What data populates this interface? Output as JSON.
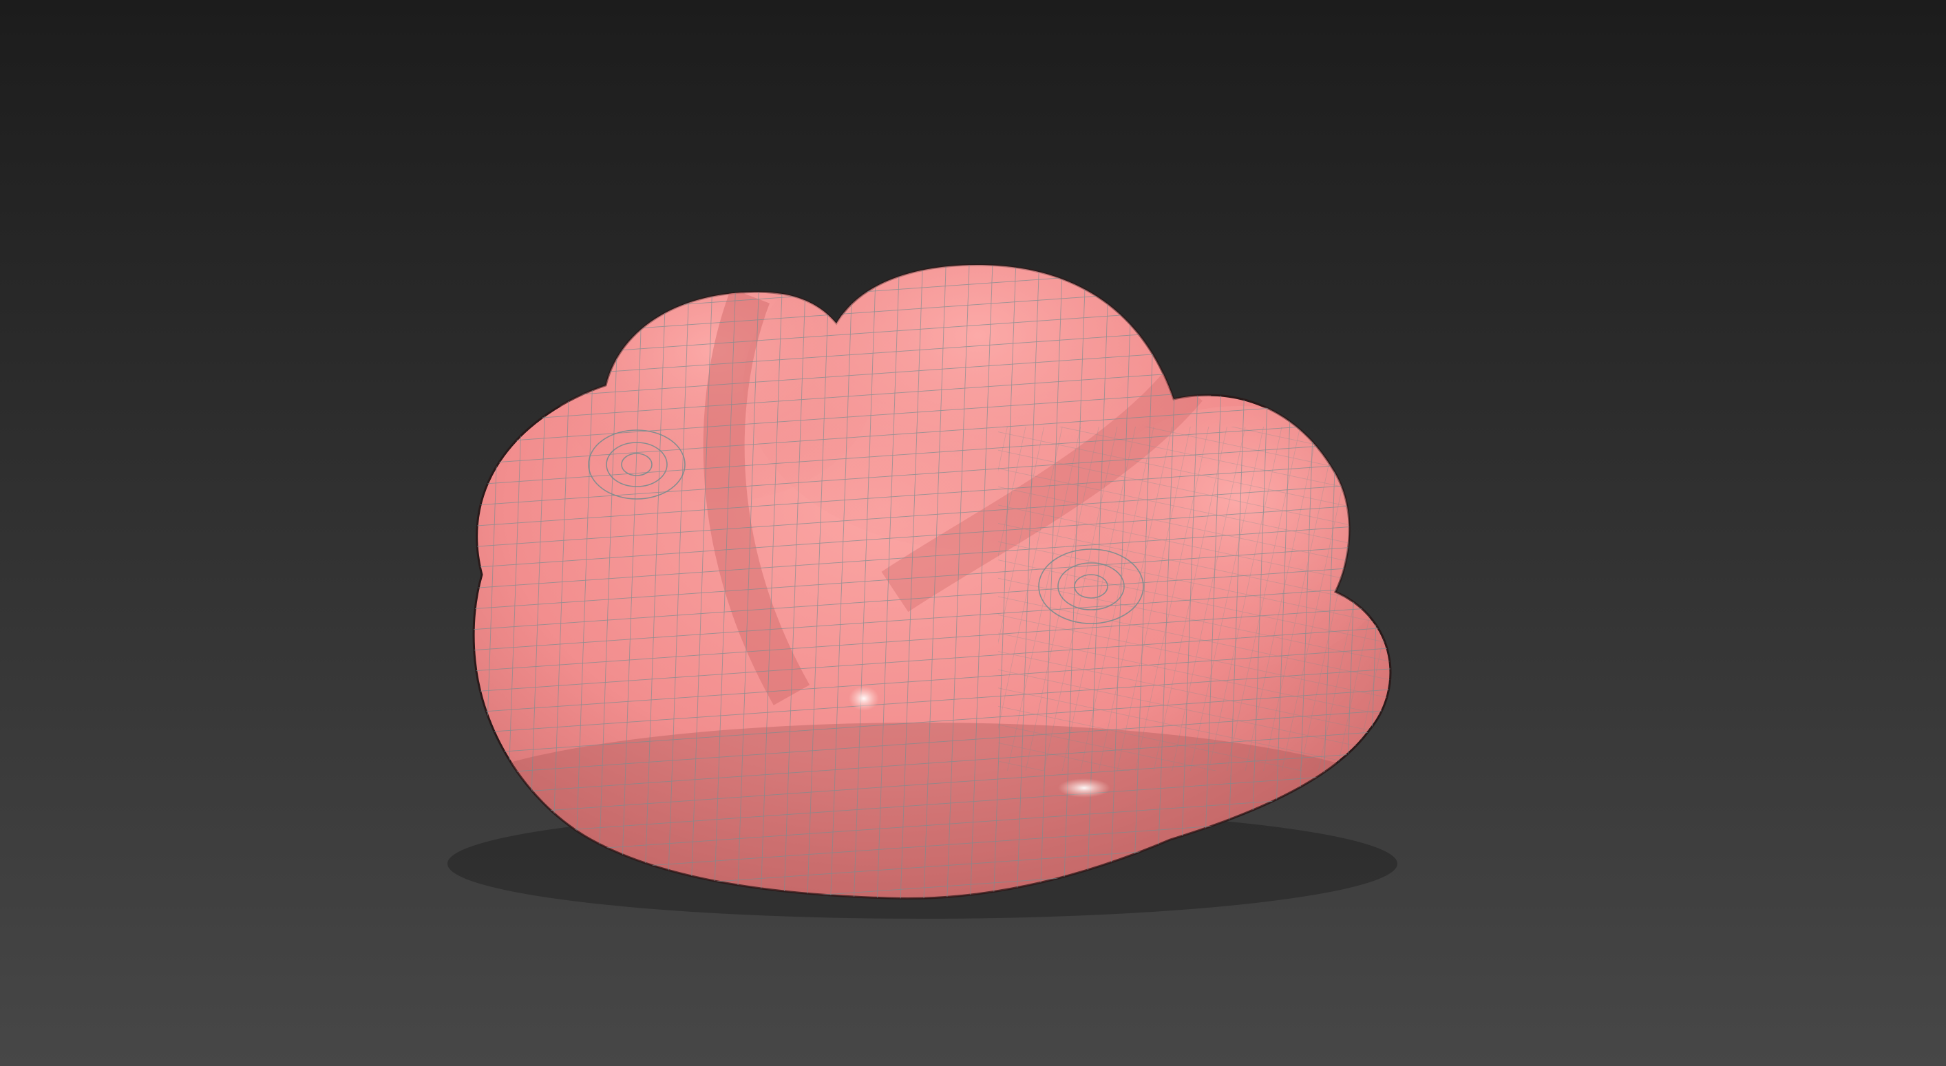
{
  "viewport": {
    "background_top": "#1c1c1c",
    "background_bottom": "#474747",
    "shading_mode": "smooth-with-wireframe"
  },
  "object": {
    "kind": "subdivided-mesh",
    "shape": "cloud-cushion",
    "base_color": "#f28e8e",
    "wire_color": "#7a8c8e",
    "highlight_color": "#ffe2dc",
    "shadow_color": "#b05e5e",
    "selected": false
  }
}
